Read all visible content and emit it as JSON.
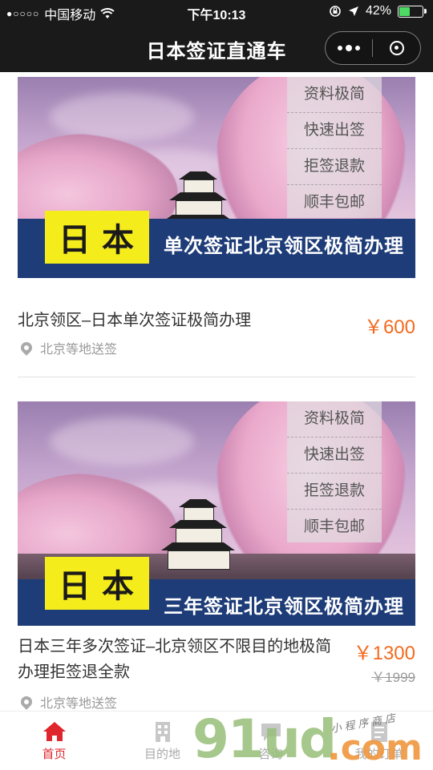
{
  "status_bar": {
    "signal_dots": "●○○○○",
    "carrier": "中国移动",
    "time": "下午10:13",
    "battery_percent": "42%",
    "battery_level": 0.42
  },
  "nav": {
    "title": "日本签证直通车"
  },
  "products": [
    {
      "tags": [
        "资料极简",
        "快速出签",
        "拒签退款",
        "顺丰包邮"
      ],
      "banner_jp": "日本",
      "banner_text": "单次签证北京领区极简办理",
      "title": "北京领区–日本单次签证极简办理",
      "price": "￥600",
      "original_price": "",
      "location": "北京等地送签"
    },
    {
      "tags": [
        "资料极简",
        "快速出签",
        "拒签退款",
        "顺丰包邮"
      ],
      "banner_jp": "日本",
      "banner_text": "三年签证北京领区极简办理",
      "title": "日本三年多次签证–北京领区不限目的地极简办理拒签退全款",
      "price": "￥1300",
      "original_price": "￥1999",
      "location": "北京等地送签"
    }
  ],
  "tabbar": {
    "tabs": [
      {
        "label": "首页",
        "icon": "home-icon",
        "active": true
      },
      {
        "label": "目的地",
        "icon": "building-icon",
        "active": false
      },
      {
        "label": "咨询",
        "icon": "chat-icon",
        "active": false
      },
      {
        "label": "我的订单",
        "icon": "order-icon",
        "active": false
      }
    ]
  },
  "watermark": {
    "main": "91ud",
    "dot_com": ".com",
    "sub": "小程序商店"
  },
  "colors": {
    "nav_bg": "#1a1a1a",
    "price": "#f46b1f",
    "active_tab": "#e0262d",
    "banner_strip": "#1d3c78",
    "banner_jp_bg": "#f5ec1c"
  }
}
